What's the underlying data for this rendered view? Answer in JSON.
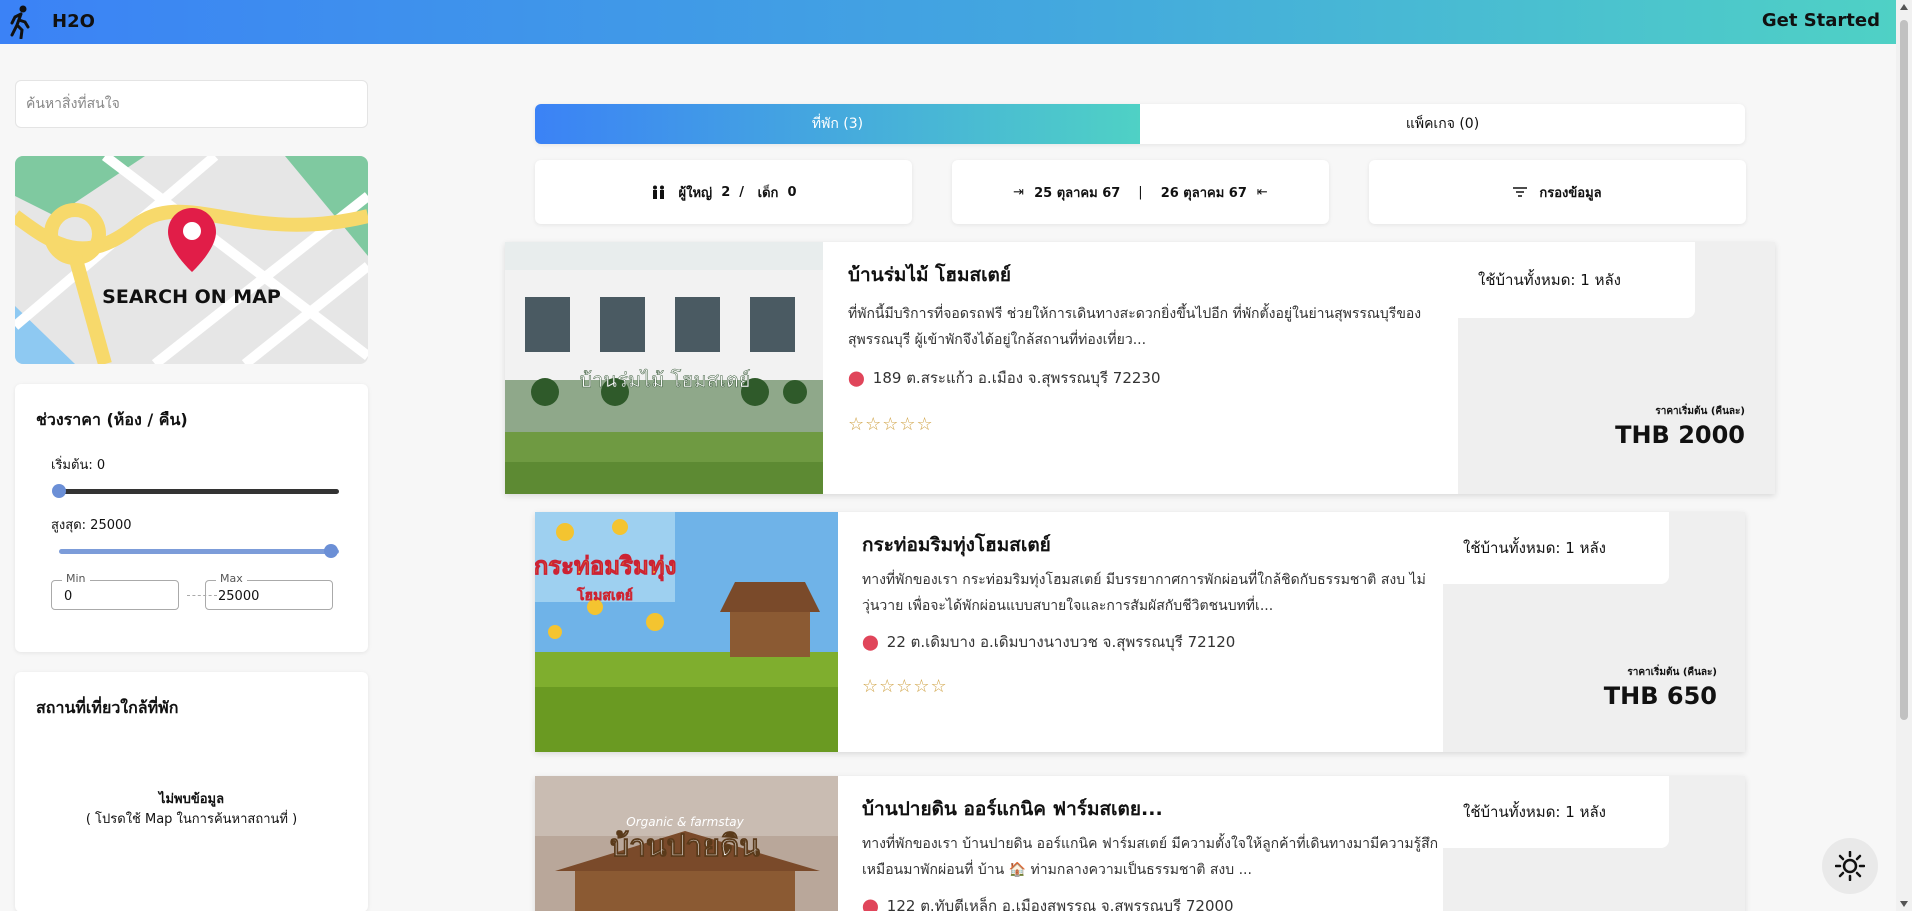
{
  "header": {
    "brand": "H2O",
    "cta_label": "Get Started",
    "logo_icon": "walking-person-icon",
    "gradient": [
      "#3b82f6",
      "#4fd1c5"
    ]
  },
  "search": {
    "placeholder": "ค้นหาสิ่งที่สนใจ",
    "value": ""
  },
  "map_card": {
    "label": "SEARCH ON MAP",
    "pin_color": "#e11d48"
  },
  "price_filter": {
    "title": "ช่วงราคา (ห้อง / คืน)",
    "start_label": "เริ่มต้น: 0",
    "max_label": "สูงสุด: 25000",
    "min_legend": "Min",
    "max_legend": "Max",
    "min_value": "0",
    "max_value": "25000",
    "range_min": 0,
    "range_max": 25000
  },
  "attractions": {
    "title": "สถานที่เที่ยวใกล้ที่พัก",
    "empty_title": "ไม่พบข้อมูล",
    "empty_hint": "( โปรดใช้ Map ในการค้นหาสถานที่ )"
  },
  "tabs": [
    {
      "label": "ที่พัก (3)",
      "active": true
    },
    {
      "label": "แพ็คเกจ (0)",
      "active": false
    }
  ],
  "filters": {
    "guests_icon": "people-icon",
    "adults_label": "ผู้ใหญ่",
    "adults_count": "2",
    "separator": "/",
    "children_label": "เด็ก",
    "children_count": "0",
    "checkin": "25 ตุลาคม 67",
    "checkout": "26 ตุลาคม 67",
    "date_separator": "|",
    "filter_label": "กรองข้อมูล"
  },
  "listings": [
    {
      "name": "บ้านร่มไม้ โฮมสเตย์",
      "desc": "ที่พักนี้มีบริการที่จอดรถฟรี ช่วยให้การเดินทางสะดวกยิ่งขึ้นไปอีก ที่พักตั้งอยู่ในย่านสุพรรณบุรีของสุพรรณบุรี ผู้เข้าพักจึงได้อยู่ใกล้สถานที่ท่องเที่ยว...",
      "address": "189 ต.สระแก้ว อ.เมือง จ.สุพรรณบุรี 72230",
      "houses": "ใช้บ้านทั้งหมด: 1 หลัง",
      "from_label": "ราคาเริ่มต้น (คืนละ)",
      "price": "THB 2000",
      "photo_sign": "บ้านร่มไม้ โฮมสเตย์",
      "rating": 0,
      "stars": "☆☆☆☆☆"
    },
    {
      "name": "กระท่อมริมทุ่งโฮมสเตย์",
      "desc": "ทางที่พักของเรา กระท่อมริมทุ่งโฮมสเตย์ มีบรรยากาศการพักผ่อนที่ใกล้ชิดกับธรรมชาติ สงบ ไม่วุ่นวาย เพื่อจะได้พักผ่อนแบบสบายใจและการสัมผัสกับชีวิตชนบทที่เ...",
      "address": "22 ต.เดิมบาง อ.เดิมบางนางบวช จ.สุพรรณบุรี 72120",
      "houses": "ใช้บ้านทั้งหมด: 1 หลัง",
      "from_label": "ราคาเริ่มต้น (คืนละ)",
      "price": "THB 650",
      "photo_sign": "กระท่อมริมทุ่ง",
      "photo_sign_sub": "โฮมสเตย์",
      "rating": 0,
      "stars": "☆☆☆☆☆"
    },
    {
      "name": "บ้านปายดิน ออร์แกนิค ฟาร์มสเตย...",
      "desc": "ทางที่พักของเรา บ้านปายดิน ออร์แกนิค ฟาร์มสเตย์ มีความตั้งใจให้ลูกค้าที่เดินทางมามีความรู้สึกเหมือนมาพักผ่อนที่ บ้าน 🏠 ท่ามกลางความเป็นธรรมชาติ สงบ ...",
      "address": "122 ต.ทับตีเหล็ก อ.เมืองสพรรณ จ.สุพรรณบุรี 72000",
      "houses": "ใช้บ้านทั้งหมด: 1 หลัง",
      "photo_sign": "บ้านปายดิน",
      "photo_sign_top": "Organic & farmstay"
    }
  ],
  "theme_toggle_icon": "sun-icon"
}
